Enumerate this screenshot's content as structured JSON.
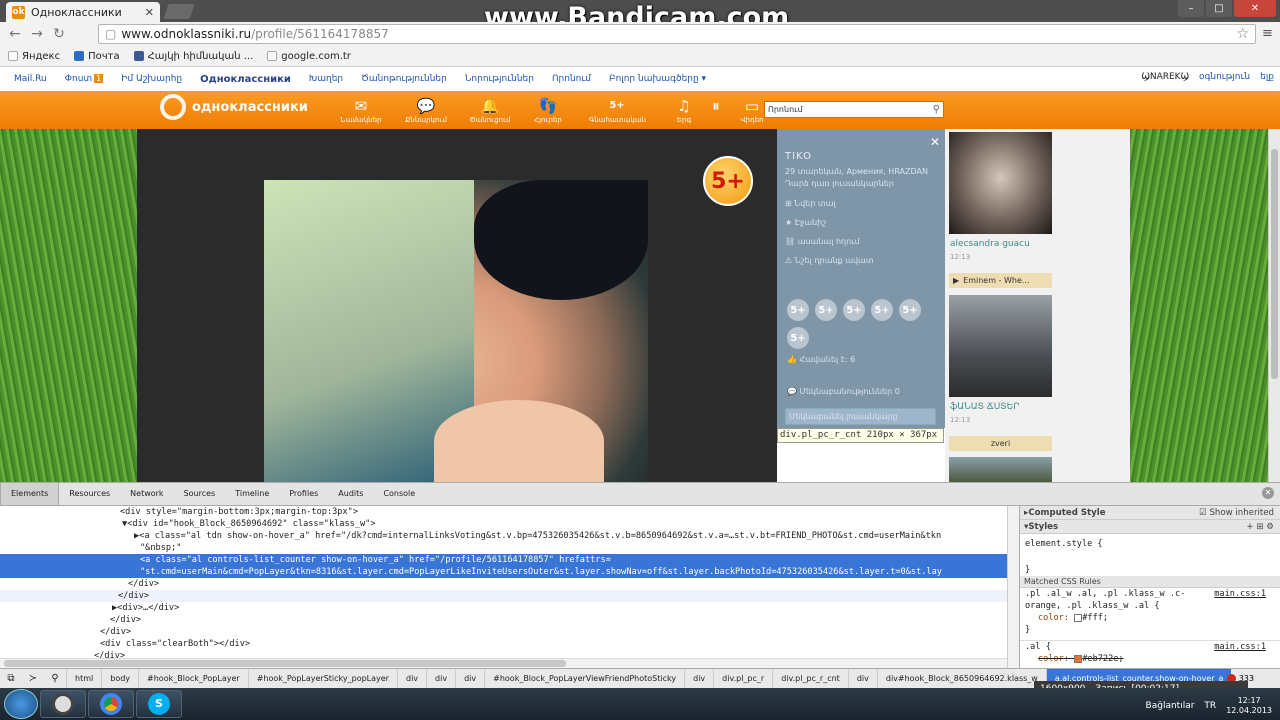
{
  "browser": {
    "tab_title": "Одноклассники",
    "url_host": "www.odnoklassniki.ru",
    "url_path": "/profile/561164178857",
    "overlay_watermark": "www.Bandicam.com",
    "bookmarks": [
      "Яндекс",
      "Почта",
      "Հայկի հիմնական ...",
      "google.com.tr"
    ]
  },
  "mailbar": {
    "items": [
      "Mail.Ru",
      "Փոստ",
      "Իմ Աշխարհը",
      "Одноклассники",
      "Խաղեր",
      "Ծանոթություններ",
      "Նորություններ",
      "Որոնում",
      "Բոլոր նախագծերը ▾"
    ],
    "mail_badge": "1",
    "user": "ϢNAREKϢ",
    "user_links": [
      "օգնություն",
      "ելք"
    ]
  },
  "okbar": {
    "logo_text": "одноклассники",
    "nav": [
      {
        "icon": "✉",
        "label": "Նամակներ"
      },
      {
        "icon": "💬",
        "label": "Քննարկում"
      },
      {
        "icon": "🔔",
        "label": "Ծանուցում"
      },
      {
        "icon": "👣",
        "label": "Հյուրեր"
      },
      {
        "icon": "5+",
        "label": "Գնահատական"
      },
      {
        "icon": "♫",
        "label": "Երգ"
      },
      {
        "icon": "⏸",
        "label": ""
      },
      {
        "icon": "▭",
        "label": "Վիդեո"
      }
    ],
    "search_placeholder": "Որոնում"
  },
  "photo_panel": {
    "rating_badge": "5+",
    "name": "TIKO",
    "details": "29 տարեկան, Армения, HRAZDAN",
    "add_friend": "Դարձ դառ լուսանկարներ",
    "actions": [
      "Նվեր տալ",
      "Էջանիշ",
      "ասանալ հղում",
      "Նշել դրանք ավատ"
    ],
    "rating_circles": [
      "5+",
      "5+",
      "5+",
      "5+",
      "5+",
      "5+"
    ],
    "likes": "Հավանել  է: 6",
    "comments": "Մեկնաբանություններ 0",
    "highlight": "Մեկնաբանել լուսանկարը",
    "close": "✕"
  },
  "inspector_tooltip": {
    "selector": "div.pl_pc_r_cnt",
    "size": "210px × 367px"
  },
  "right_column": {
    "friend1_name": "alecsandra guacu",
    "friend1_time": "12:13",
    "music": "Eminem - Whe...",
    "friend2_name": "ֆԱՆԱՏ ՃՍՏԵՐ",
    "friend2_time": "12:13",
    "bar2": "zveri"
  },
  "devtools": {
    "tabs": [
      "Elements",
      "Resources",
      "Network",
      "Sources",
      "Timeline",
      "Profiles",
      "Audits",
      "Console"
    ],
    "dom_lines": [
      {
        "indent": 120,
        "html": "<div style=\"margin-bottom:3px;margin-top:3px\">",
        "sel": false
      },
      {
        "indent": 122,
        "html": "▼<div id=\"hook_Block_8650964692\" class=\"klass_w\">",
        "sel": false
      },
      {
        "indent": 134,
        "html": "▶<a class=\"al tdn show-on-hover_a\" href=\"/dk?cmd=internalLinksVoting&st.v.bp=475326035426&st.v.b=8650964692&st.v.a=…st.v.bt=FRIEND_PHOTO&st.cmd=userMain&tkn",
        "sel": false
      },
      {
        "indent": 140,
        "html": "\"&nbsp;\"",
        "sel": false
      },
      {
        "indent": 140,
        "html": "<a class=\"al controls-list_counter show-on-hover_a\" href=\"/profile/561164178857\" hrefattrs=",
        "sel": true
      },
      {
        "indent": 140,
        "html": "\"st.cmd=userMain&cmd=PopLayer&tkn=8316&st.layer.cmd=PopLayerLikeInviteUsersOuter&st.layer.showNav=off&st.layer.backPhotoId=475326035426&st.layer.t=0&st.lay",
        "sel": true
      },
      {
        "indent": 128,
        "html": "</div>",
        "sel": false
      },
      {
        "indent": 118,
        "html": "</div>",
        "sel": false
      },
      {
        "indent": 112,
        "html": "▶<div>…</div>",
        "sel": false
      },
      {
        "indent": 110,
        "html": "</div>",
        "sel": false
      },
      {
        "indent": 100,
        "html": "</div>",
        "sel": false
      },
      {
        "indent": 100,
        "html": "<div class=\"clearBoth\"></div>",
        "sel": false
      },
      {
        "indent": 94,
        "html": "</div>",
        "sel": false
      }
    ],
    "styles": {
      "computed_header": "Computed Style",
      "show_inherited": "Show inherited",
      "styles_header": "Styles",
      "element_style": "element.style {",
      "element_style_close": "}",
      "matched_rules": "Matched CSS Rules",
      "rule1_selector": ".pl .al_w .al, .pl .klass_w .c-orange, .pl .klass_w .al {",
      "rule1_src": "main.css:1",
      "rule1_prop": "color: ",
      "rule1_val": "#fff;",
      "rule1_close": "}",
      "rule2_selector": ".al {",
      "rule2_src": "main.css:1",
      "rule2_prop": "color: ",
      "rule2_val": "#eb722e;",
      "color_fff": "#ffffff",
      "color_orange": "#eb722e"
    },
    "breadcrumbs": [
      "html",
      "body",
      "#hook_Block_PopLayer",
      "#hook_PopLayerSticky_popLayer",
      "div",
      "div",
      "div",
      "#hook_Block_PopLayerViewFriendPhotoSticky",
      "div",
      "div.pl_pc_r",
      "div.pl_pc_r_cnt",
      "div",
      "div#hook_Block_8650964692.klass_w",
      "a.al.controls-list_counter.show-on-hover_a"
    ],
    "error_count": "333"
  },
  "bandicam_bar": {
    "resolution": "1600x900",
    "record": "Запись [00:02:17]"
  },
  "taskbar": {
    "lang": "TR",
    "network": "Bağlantılar",
    "time": "12:17",
    "date": "12.04.2013"
  },
  "colors": {
    "ok_orange": "#f68b0f",
    "selection": "#3875d7"
  }
}
